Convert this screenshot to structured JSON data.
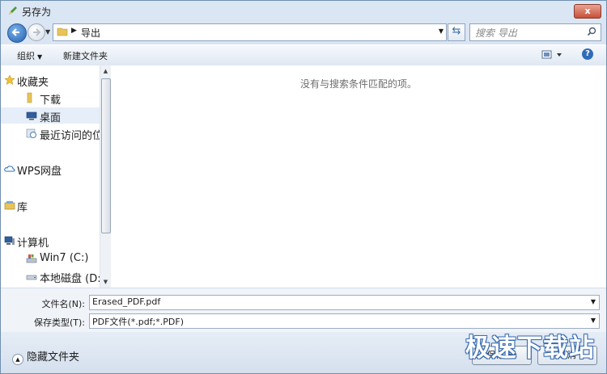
{
  "window": {
    "title": "另存为",
    "close_label": "x"
  },
  "nav": {
    "address_path": "导出",
    "search_placeholder": "搜索 导出"
  },
  "toolbar": {
    "organize_label": "组织",
    "new_folder_label": "新建文件夹",
    "help_label": "?"
  },
  "sidebar": {
    "items": [
      {
        "label": "收藏夹",
        "icon": "star-icon"
      },
      {
        "label": "下载",
        "icon": "folder-icon"
      },
      {
        "label": "桌面",
        "icon": "desktop-icon"
      },
      {
        "label": "最近访问的位置",
        "icon": "recent-places-icon"
      },
      {
        "label": "WPS网盘",
        "icon": "cloud-icon"
      },
      {
        "label": "库",
        "icon": "library-icon"
      },
      {
        "label": "计算机",
        "icon": "computer-icon"
      },
      {
        "label": "Win7 (C:)",
        "icon": "system-drive-icon"
      },
      {
        "label": "本地磁盘 (D:)",
        "icon": "hard-drive-icon"
      }
    ]
  },
  "content": {
    "empty_message": "没有与搜索条件匹配的项。"
  },
  "form": {
    "filename_label": "文件名(N):",
    "filename_value": "Erased_PDF.pdf",
    "filetype_label": "保存类型(T):",
    "filetype_value": "PDF文件(*.pdf;*.PDF)"
  },
  "footer": {
    "hide_folders_label": "隐藏文件夹",
    "save_label": "保存(S)",
    "cancel_label": "取消"
  },
  "watermark": {
    "text": "极速下载站"
  },
  "colors": {
    "accent": "#2f6bb7",
    "chrome": "#d3dfee"
  }
}
